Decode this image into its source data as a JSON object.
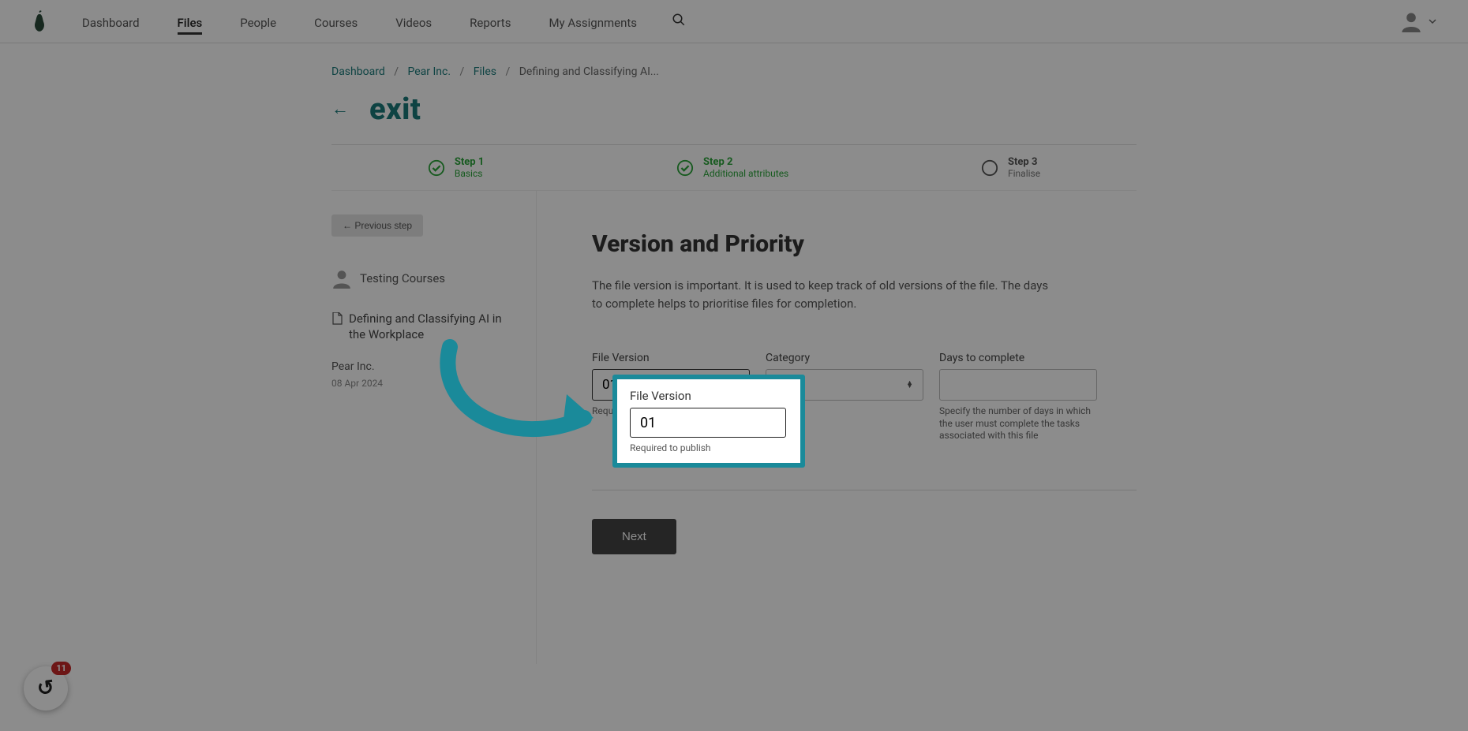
{
  "nav": {
    "items": [
      "Dashboard",
      "Files",
      "People",
      "Courses",
      "Videos",
      "Reports",
      "My Assignments"
    ],
    "active_index": 1
  },
  "breadcrumbs": {
    "items": [
      "Dashboard",
      "Pear Inc.",
      "Files"
    ],
    "current": "Defining and Classifying AI..."
  },
  "exit_label": "exit",
  "prev_step_label": "← Previous step",
  "stepper": {
    "steps": [
      {
        "label": "Step 1",
        "sub": "Basics",
        "state": "done"
      },
      {
        "label": "Step 2",
        "sub": "Additional attributes",
        "state": "done"
      },
      {
        "label": "Step 3",
        "sub": "Finalise",
        "state": "pending"
      }
    ]
  },
  "sidebar": {
    "author": "Testing Courses",
    "file_title": "Defining and Classifying AI in the Workplace",
    "org": "Pear Inc.",
    "date": "08 Apr 2024"
  },
  "section": {
    "title": "Version and Priority",
    "description": "The file version is important. It is used to keep track of old versions of the file. The days to complete helps to prioritise files for completion."
  },
  "fields": {
    "version": {
      "label": "File Version",
      "value": "01",
      "help": "Required to publish"
    },
    "category": {
      "label": "Category",
      "value": ""
    },
    "days": {
      "label": "Days to complete",
      "value": "",
      "help": "Specify the number of days in which the user must complete the tasks associated with this file"
    }
  },
  "next_label": "Next",
  "chat": {
    "badge": "11"
  }
}
